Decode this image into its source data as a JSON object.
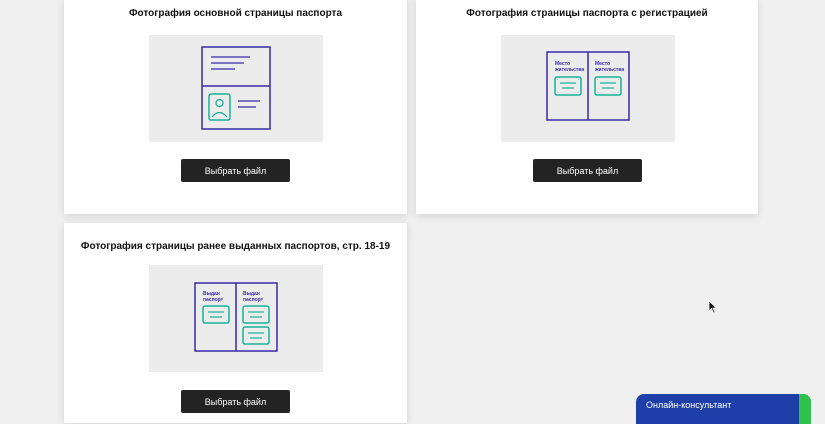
{
  "cards": [
    {
      "title": "Фотография основной страницы паспорта",
      "button": "Выбрать файл"
    },
    {
      "title": "Фотография страницы паспорта с регистрацией",
      "button": "Выбрать файл",
      "labels": [
        "Место жительства",
        "Место жительства"
      ]
    },
    {
      "title": "Фотография страницы ранее выданных паспортов, стр. 18-19",
      "button": "Выбрать файл",
      "labels": [
        "Выдан паспорт",
        "Выдан паспорт"
      ]
    }
  ],
  "chat": {
    "label": "Онлайн-консультант"
  },
  "colors": {
    "accent_purple": "#3a2aa8",
    "accent_teal": "#17b39a",
    "button_bg": "#232323",
    "chat_blue": "#1f3fa8",
    "chat_green": "#2fc24a"
  },
  "icons": [
    "passport-main-page-icon",
    "passport-registration-page-icon",
    "passport-previous-issued-icon",
    "mouse-cursor-icon"
  ]
}
